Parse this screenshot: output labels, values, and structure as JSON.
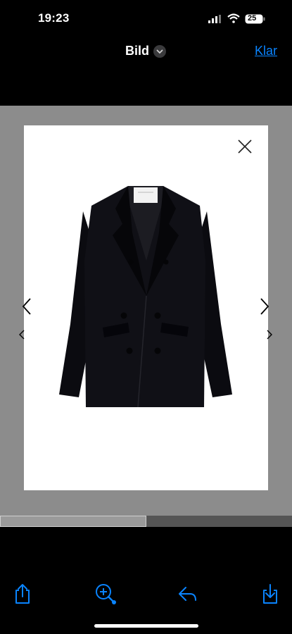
{
  "status": {
    "time": "19:23",
    "battery": "25"
  },
  "nav": {
    "title": "Bild",
    "done_label": "Klar"
  },
  "product": {
    "brand_label": ""
  },
  "viewer": {
    "scroll_fraction": 0.5
  },
  "toolbar": {
    "icons": [
      "share-icon",
      "zoom-icon",
      "reply-icon",
      "save-icon"
    ]
  },
  "colors": {
    "accent": "#0a84ff",
    "overlay": "#8c8c8c"
  }
}
